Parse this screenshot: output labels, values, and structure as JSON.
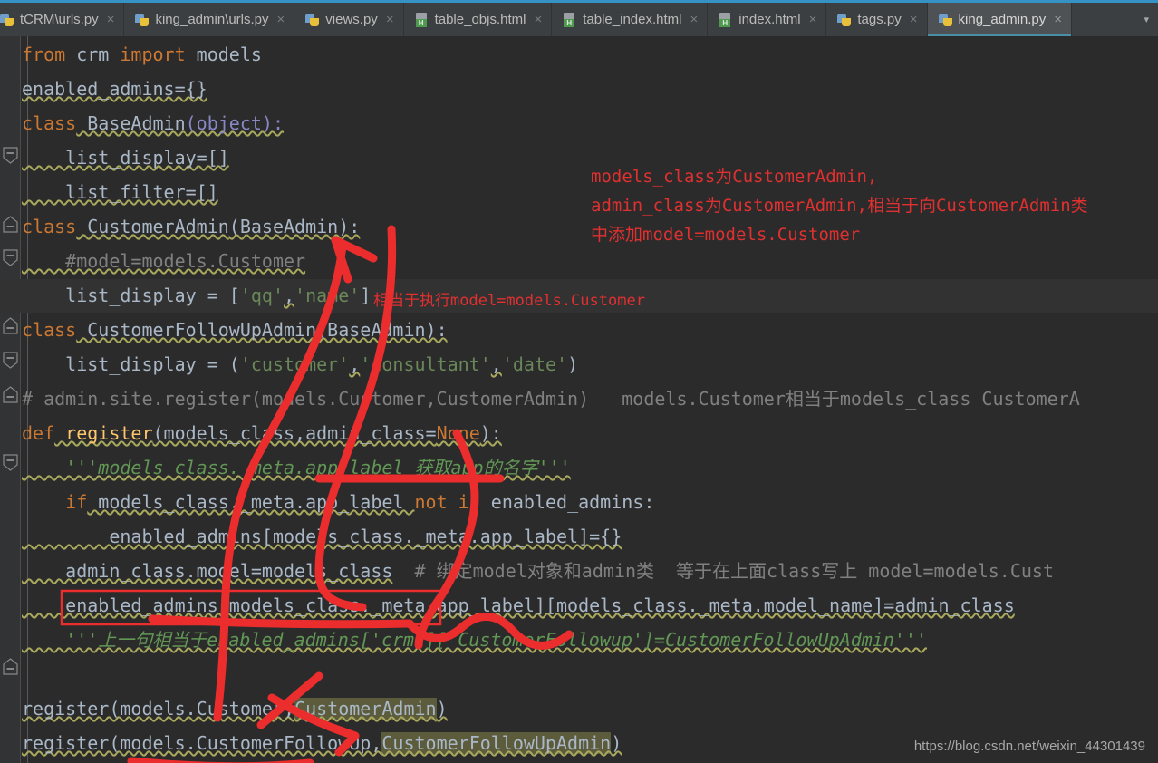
{
  "window": {
    "accent_color": "#3592c4",
    "tabbar_bg": "#3c3f41",
    "editor_bg": "#2b2b2b",
    "active_tab_underline": "#4a8fa8"
  },
  "tabs": [
    {
      "label": "tCRM\\urls.py",
      "icon": "python-file-icon",
      "active": false,
      "truncated": true
    },
    {
      "label": "king_admin\\urls.py",
      "icon": "python-file-icon",
      "active": false
    },
    {
      "label": "views.py",
      "icon": "python-file-icon",
      "active": false
    },
    {
      "label": "table_objs.html",
      "icon": "html-file-icon",
      "active": false
    },
    {
      "label": "table_index.html",
      "icon": "html-file-icon",
      "active": false
    },
    {
      "label": "index.html",
      "icon": "html-file-icon",
      "active": false
    },
    {
      "label": "tags.py",
      "icon": "python-file-icon",
      "active": false
    },
    {
      "label": "king_admin.py",
      "icon": "python-file-icon",
      "active": true
    }
  ],
  "tab_close_glyph": "×",
  "tab_overflow_glyph": "▾",
  "code_lines": [
    "from crm import models",
    "enabled_admins={}",
    "class BaseAdmin(object):",
    "    list_display=[]",
    "    list_filter=[]",
    "class CustomerAdmin(BaseAdmin):",
    "    #model=models.Customer",
    "    list_display = ['qq','name']",
    "class CustomerFollowUpAdmin(BaseAdmin):",
    "    list_display = ('customer','consultant','date')",
    "# admin.site.register(models.Customer,CustomerAdmin)   models.Customer相当于models_class CustomerA",
    "def register(models_class,admin_class=None):",
    "    '''models_class._meta.app_label 获取app的名字'''",
    "    if models_class._meta.app_label not in enabled_admins:",
    "        enabled_admins[models_class._meta.app_label]={}",
    "    admin_class.model=models_class  # 绑定model对象和admin类  等于在上面class写上 model=models.Cust",
    "    enabled_admins[models_class._meta.app_label][models_class._meta.model_name]=admin_class",
    "    '''上一句相当于enabled_admins['crm']['CustomerFollowup']=CustomerFollowUpAdmin'''",
    "register(models.Customer,CustomerAdmin)",
    "register(models.CustomerFollowUp,CustomerFollowUpAdmin)"
  ],
  "tokens": {
    "l1_from": "from",
    "l1_crm": " crm ",
    "l1_import": "import",
    "l1_models": " models",
    "l2": "enabled_admins={}",
    "l3_class": "class",
    "l3_name": " BaseAdmin",
    "l3_rest": "(object):",
    "l4": "    list_display=[]",
    "l5": "    list_filter=[]",
    "l6_class": "class",
    "l6_name": " CustomerAdmin",
    "l6_rest": "(BaseAdmin):",
    "l7_comment": "    #model=models.Customer",
    "l8_head": "    list_display = [",
    "l8_qq": "'qq'",
    "l8_comma": ",",
    "l8_name": "'name'",
    "l8_tail": "]",
    "l9_class": "class",
    "l9_name": " CustomerFollowUpAdmin",
    "l9_rest": "(BaseAdmin):",
    "l10_head": "    list_display = (",
    "l10_a": "'customer'",
    "l10_c1": ",",
    "l10_b": "'consultant'",
    "l10_c2": ",",
    "l10_c": "'date'",
    "l10_tail": ")",
    "l11_comment": "# admin.site.register(models.Customer,CustomerAdmin)   models.Customer相当于models_class CustomerA",
    "l12_def": "def",
    "l12_name": " register",
    "l12_open": "(models_class,admin_class=",
    "l12_none": "None",
    "l12_tail": "):",
    "l13_doc": "    '''models_class._meta.app_label 获取app的名字'''",
    "l14_if": "    if",
    "l14_mid": " models_class._meta.app_label ",
    "l14_not": "not",
    "l14_in": " in",
    "l14_tail": " enabled_admins:",
    "l15": "        enabled_admins[models_class._meta.app_label]={}",
    "l16_code": "    admin_class.model=models_class",
    "l16_comment": "  # 绑定model对象和admin类  等于在上面class写上 model=models.Cust",
    "l17": "    enabled_admins[models_class._meta.app_label][models_class._meta.model_name]=admin_class",
    "l18_doc": "    '''上一句相当于enabled_admins['crm']['CustomerFollowup']=CustomerFollowUpAdmin'''",
    "l19_head": "register(models.Customer,",
    "l19_sel": "CustomerAdmin",
    "l19_tail": ")",
    "l20_head": "register(models.CustomerFollowUp,",
    "l20_sel": "CustomerFollowUpAdmin",
    "l20_tail": ")"
  },
  "annotations": {
    "color": "#e03030",
    "note_top": [
      "models_class为CustomerAdmin,",
      "admin_class为CustomerAdmin,相当于向CustomerAdmin类",
      "中添加model=models.Customer"
    ],
    "note_inline": "相当于执行model=models.Customer"
  },
  "watermark": "https://blog.csdn.net/weixin_44301439"
}
